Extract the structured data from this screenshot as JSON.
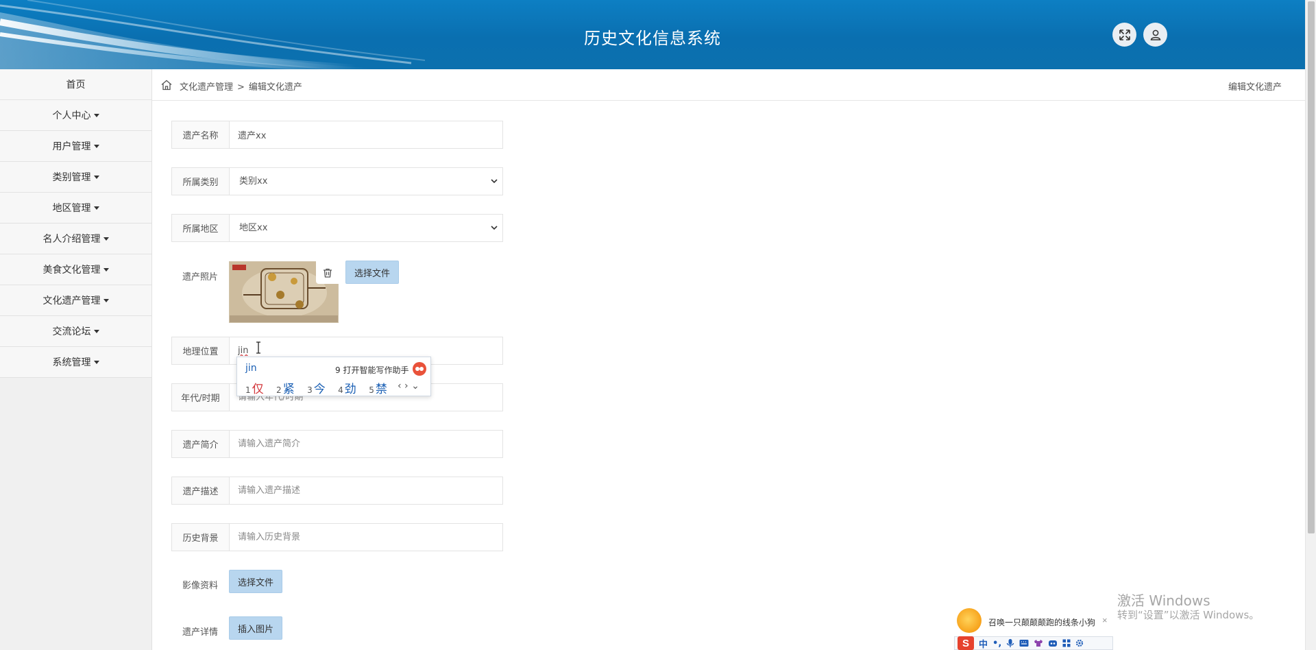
{
  "header": {
    "title": "历史文化信息系统",
    "expand_icon": "expand-arrows-icon",
    "user_icon": "user-icon"
  },
  "sidebar": {
    "items": [
      {
        "label": "首页",
        "has_caret": false
      },
      {
        "label": "个人中心",
        "has_caret": true
      },
      {
        "label": "用户管理",
        "has_caret": true
      },
      {
        "label": "类别管理",
        "has_caret": true
      },
      {
        "label": "地区管理",
        "has_caret": true
      },
      {
        "label": "名人介绍管理",
        "has_caret": true
      },
      {
        "label": "美食文化管理",
        "has_caret": true
      },
      {
        "label": "文化遗产管理",
        "has_caret": true
      },
      {
        "label": "交流论坛",
        "has_caret": true
      },
      {
        "label": "系统管理",
        "has_caret": true
      }
    ]
  },
  "breadcrumb": {
    "home_icon": "home-icon",
    "parent": "文化遗产管理",
    "separator": ">",
    "current": "编辑文化遗产",
    "page_title": "编辑文化遗产"
  },
  "form": {
    "name": {
      "label": "遗产名称",
      "value": "遗产xx"
    },
    "category": {
      "label": "所属类别",
      "value": "类别xx"
    },
    "region": {
      "label": "所属地区",
      "value": "地区xx"
    },
    "photo": {
      "label": "遗产照片",
      "button": "选择文件",
      "delete_icon": "trash-icon"
    },
    "location": {
      "label": "地理位置",
      "value": "jin"
    },
    "era": {
      "label": "年代/时期",
      "placeholder": "请输入年代/时期"
    },
    "intro": {
      "label": "遗产简介",
      "placeholder": "请输入遗产简介"
    },
    "description": {
      "label": "遗产描述",
      "placeholder": "请输入遗产描述"
    },
    "background": {
      "label": "历史背景",
      "placeholder": "请输入历史背景"
    },
    "media": {
      "label": "影像资料",
      "button": "选择文件"
    },
    "detail": {
      "label": "遗产详情",
      "button": "插入图片"
    }
  },
  "ime": {
    "composition": "jin",
    "assistant_text": "9 打开智能写作助手",
    "candidates": [
      {
        "n": "1",
        "c": "仅"
      },
      {
        "n": "2",
        "c": "紧"
      },
      {
        "n": "3",
        "c": "今"
      },
      {
        "n": "4",
        "c": "劲"
      },
      {
        "n": "5",
        "c": "禁"
      }
    ],
    "nav": "‹ › ⌄"
  },
  "watermark": {
    "line1": "激活 Windows",
    "line2": "转到“设置”以激活 Windows。"
  },
  "tip": {
    "text": "召唤一只颠颠颠跑的线条小狗",
    "close": "×"
  },
  "toolbar": {
    "mode": "中",
    "punct": "•,"
  }
}
